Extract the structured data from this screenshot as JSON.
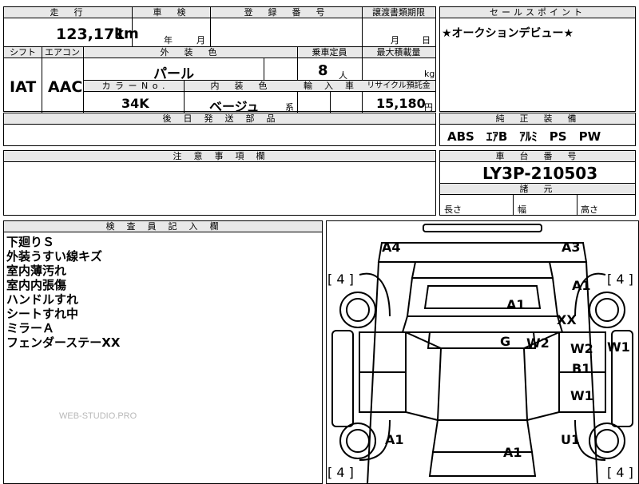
{
  "top_header": {
    "mileage_label": "走　行",
    "inspection_label": "車　検",
    "registration_label": "登　録　番　号",
    "transfer_label": "譲渡書類期限",
    "sales_point_label": "セールスポイント"
  },
  "mileage": {
    "value": "123,171",
    "unit": "km"
  },
  "inspection": {
    "year": "年",
    "month": "月"
  },
  "transfer": {
    "month": "月",
    "day": "日"
  },
  "sales_point": {
    "text": "★オークションデビュー★"
  },
  "row2": {
    "shift_label": "シフト",
    "aircon_label": "エアコン",
    "exterior_label": "外　装　色",
    "capacity_label": "乗車定員",
    "max_load_label": "最大積載量",
    "shift_value": "IAT",
    "aircon_value": "AAC",
    "exterior_value": "パール",
    "capacity_value": "8",
    "capacity_unit": "人",
    "max_load_unit": "kg"
  },
  "row3": {
    "color_no_label": "カ ラ ー  N o .",
    "interior_label": "内　装　色",
    "import_label": "輸　入　車",
    "recycle_label": "リサイクル預託金",
    "color_no_value": "34K",
    "interior_value": "ベージュ",
    "interior_suffix": "系",
    "recycle_value": "15,180",
    "recycle_unit": "円"
  },
  "later_parts": {
    "label": "後　日　発　送　部　品"
  },
  "genuine_equipment": {
    "label": "純　正　装　備",
    "value": "ABS　ｴｱB　ｱﾙﾐ　PS　PW"
  },
  "notes": {
    "label": "注　意　事　項　欄"
  },
  "chassis": {
    "label": "車　台　番　号",
    "value": "LY3P-210503"
  },
  "dimensions": {
    "label": "諸　元",
    "length": "長さ",
    "width": "幅",
    "height": "高さ"
  },
  "inspector": {
    "label": "検　査　員　記　入　欄",
    "lines": [
      "下廻りＳ",
      "外装うすい線キズ",
      "室内薄汚れ",
      "室内内張傷",
      "ハンドルすれ",
      "シートすれ中",
      "ミラーＡ",
      "フェンダーステーXX"
    ]
  },
  "watermark": "WEB-STUDIO.PRO",
  "diagram": {
    "marks": [
      "A4",
      "A3",
      "A1",
      "A1",
      "XX",
      "G",
      "W2",
      "W2",
      "W1",
      "B1",
      "W1",
      "A1",
      "U1",
      "A1"
    ],
    "tires": [
      "[ 4 ]",
      "[ 4 ]",
      "[ 4 ]",
      "[ 4 ]"
    ]
  }
}
